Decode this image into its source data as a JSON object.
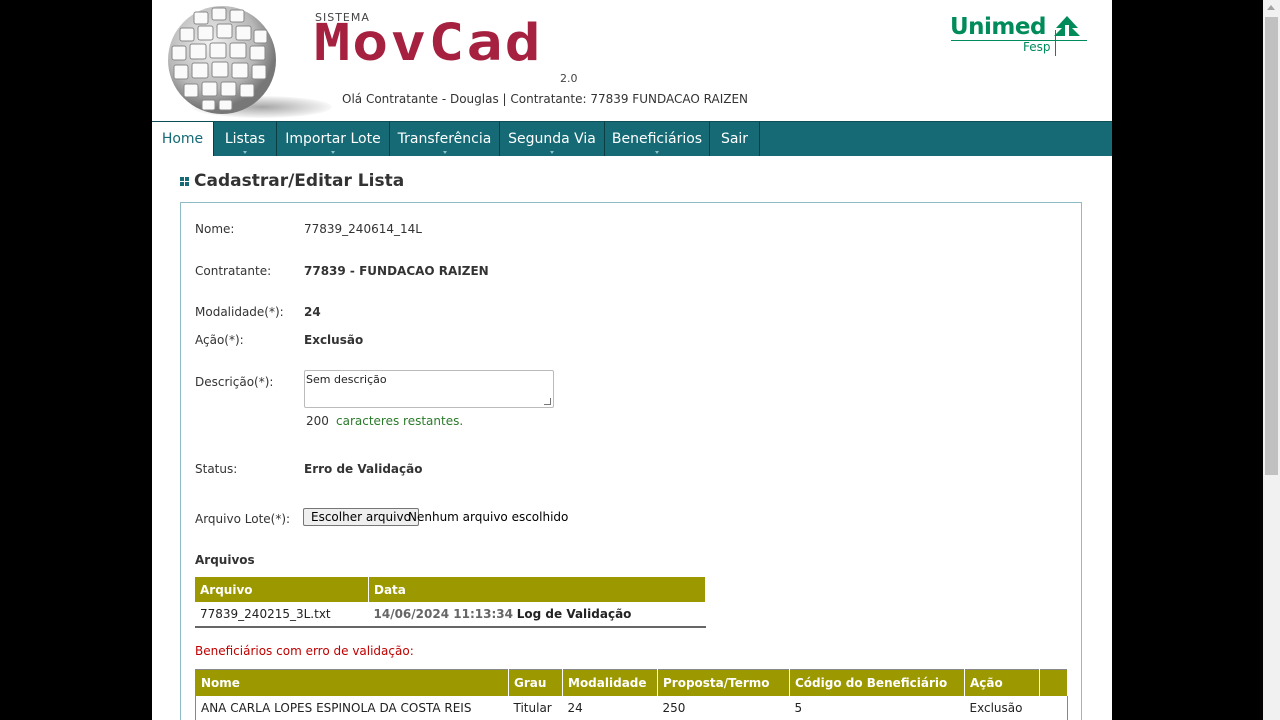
{
  "header": {
    "sistema": "SISTEMA",
    "logo": "MovCad",
    "version": "2.0",
    "greeting": "Olá Contratante - Douglas | Contratante: 77839 FUNDACAO RAIZEN",
    "brand": "Unimed",
    "brand_sub": "Fesp"
  },
  "nav": [
    {
      "label": "Home"
    },
    {
      "label": "Listas"
    },
    {
      "label": "Importar Lote"
    },
    {
      "label": "Transferência"
    },
    {
      "label": "Segunda Via"
    },
    {
      "label": "Beneficiários"
    },
    {
      "label": "Sair"
    }
  ],
  "page_title": "Cadastrar/Editar Lista",
  "form": {
    "nome_label": "Nome:",
    "nome": "77839_240614_14L",
    "contratante_label": "Contratante:",
    "contratante": "77839 - FUNDACAO RAIZEN",
    "modalidade_label": "Modalidade(*):",
    "modalidade": "24",
    "acao_label": "Ação(*):",
    "acao": "Exclusão",
    "descricao_label": "Descrição(*):",
    "descricao": "Sem descrição",
    "counter": "200",
    "counter_text": "caracteres restantes.",
    "status_label": "Status:",
    "status": "Erro de Validação",
    "arquivo_label": "Arquivo Lote(*):",
    "file_button": "Escolher arquivo",
    "file_none": "Nenhum arquivo escolhido"
  },
  "arquivos": {
    "title": "Arquivos",
    "headers": [
      "Arquivo",
      "Data"
    ],
    "rows": [
      {
        "arquivo": "77839_240215_3L.txt",
        "data": "14/06/2024 11:13:34",
        "log": "Log de Validação"
      }
    ]
  },
  "erros": {
    "title": "Beneficiários com erro de validação:",
    "headers": [
      "Nome",
      "Grau",
      "Modalidade",
      "Proposta/Termo",
      "Código do Beneficiário",
      "Ação"
    ],
    "rows": [
      {
        "nome": "ANA CARLA LOPES ESPINOLA DA COSTA REIS",
        "grau": "Titular",
        "modalidade": "24",
        "proposta": "250",
        "codigo": "5",
        "acao": "Exclusão"
      }
    ]
  },
  "colors": {
    "nav_bg": "#166a75",
    "table_header": "#9b9800",
    "logo": "#a5213f",
    "brand": "#008b5a"
  }
}
